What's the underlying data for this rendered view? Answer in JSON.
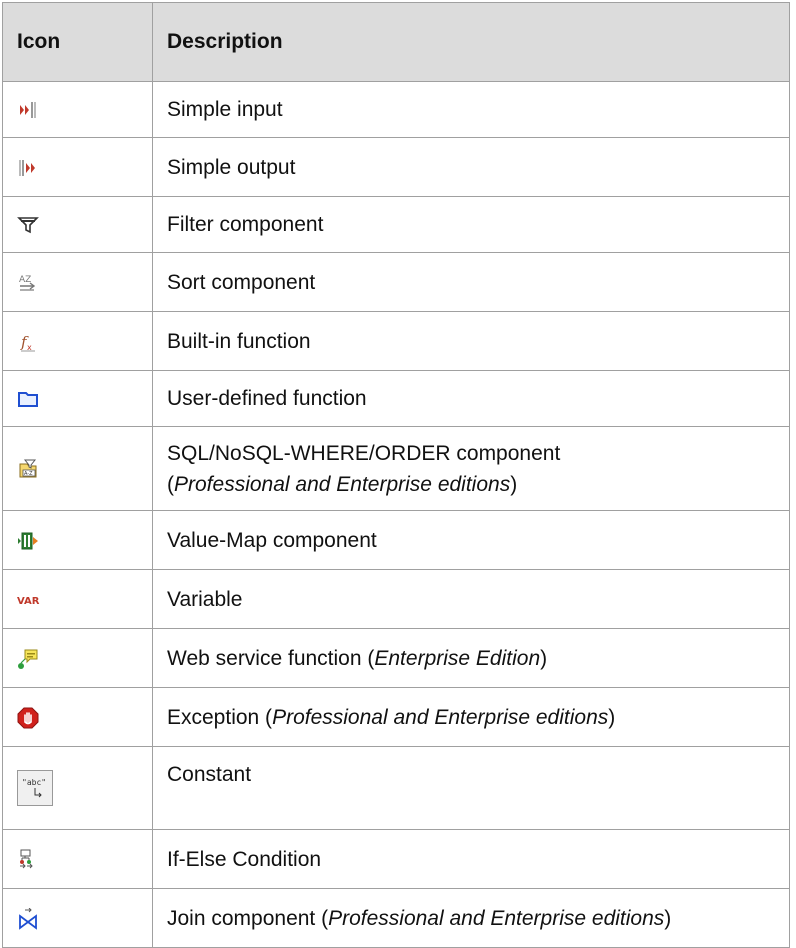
{
  "table": {
    "headers": {
      "icon": "Icon",
      "description": "Description"
    },
    "rows": [
      {
        "icon": "simple-input-icon",
        "desc": "Simple input"
      },
      {
        "icon": "simple-output-icon",
        "desc": "Simple output"
      },
      {
        "icon": "filter-icon",
        "desc": "Filter component"
      },
      {
        "icon": "sort-icon",
        "desc": "Sort component"
      },
      {
        "icon": "builtin-function-icon",
        "desc": "Built-in function"
      },
      {
        "icon": "user-defined-function-icon",
        "desc": "User-defined function"
      },
      {
        "icon": "sql-where-order-icon",
        "desc": "SQL/NoSQL-WHERE/ORDER component",
        "desc_open": "(",
        "desc_em": "Professional and Enterprise editions",
        "desc_close": ")"
      },
      {
        "icon": "value-map-icon",
        "desc": "Value-Map component"
      },
      {
        "icon": "variable-icon",
        "desc": "Variable",
        "icon_text": "VAR"
      },
      {
        "icon": "web-service-icon",
        "desc": "Web service function (",
        "desc_em": "Enterprise Edition",
        "desc_close": ")"
      },
      {
        "icon": "exception-icon",
        "desc": "Exception (",
        "desc_em": "Professional and Enterprise editions",
        "desc_close": ")"
      },
      {
        "icon": "constant-icon",
        "desc": "Constant",
        "icon_text": "\"abc\""
      },
      {
        "icon": "if-else-icon",
        "desc": "If-Else Condition"
      },
      {
        "icon": "join-icon",
        "desc": "Join component (",
        "desc_em": "Professional and Enterprise editions",
        "desc_close": ")"
      }
    ]
  },
  "colors": {
    "header_bg": "#dcdcdc",
    "border": "#a0a0a0",
    "icon_red": "#c0392b",
    "icon_blue": "#1f4fd1"
  }
}
